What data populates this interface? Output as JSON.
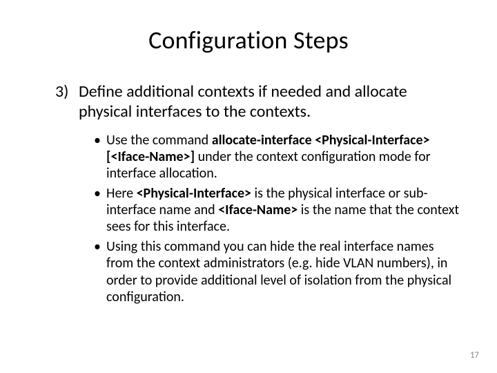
{
  "title": "Configuration Steps",
  "list": {
    "number": "3)",
    "text": "Define additional contexts if needed and allocate physical interfaces to the contexts."
  },
  "bullets": {
    "b1": {
      "t1": "Use the command ",
      "cmd": "allocate-interface <Physical-Interface> [<Iface-Name>]",
      "t2": " under the context configuration mode for interface allocation."
    },
    "b2": {
      "t1": "Here ",
      "p1": "<Physical-Interface>",
      "t2": " is the physical interface or sub-interface name and ",
      "p2": "<Iface-Name>",
      "t3": " is the name that the context sees for this interface."
    },
    "b3": {
      "t1": "Using this command you can hide the real interface names from the context administrators (e.g. hide VLAN numbers), in order to provide additional level of isolation from the physical configuration."
    }
  },
  "page": "17"
}
